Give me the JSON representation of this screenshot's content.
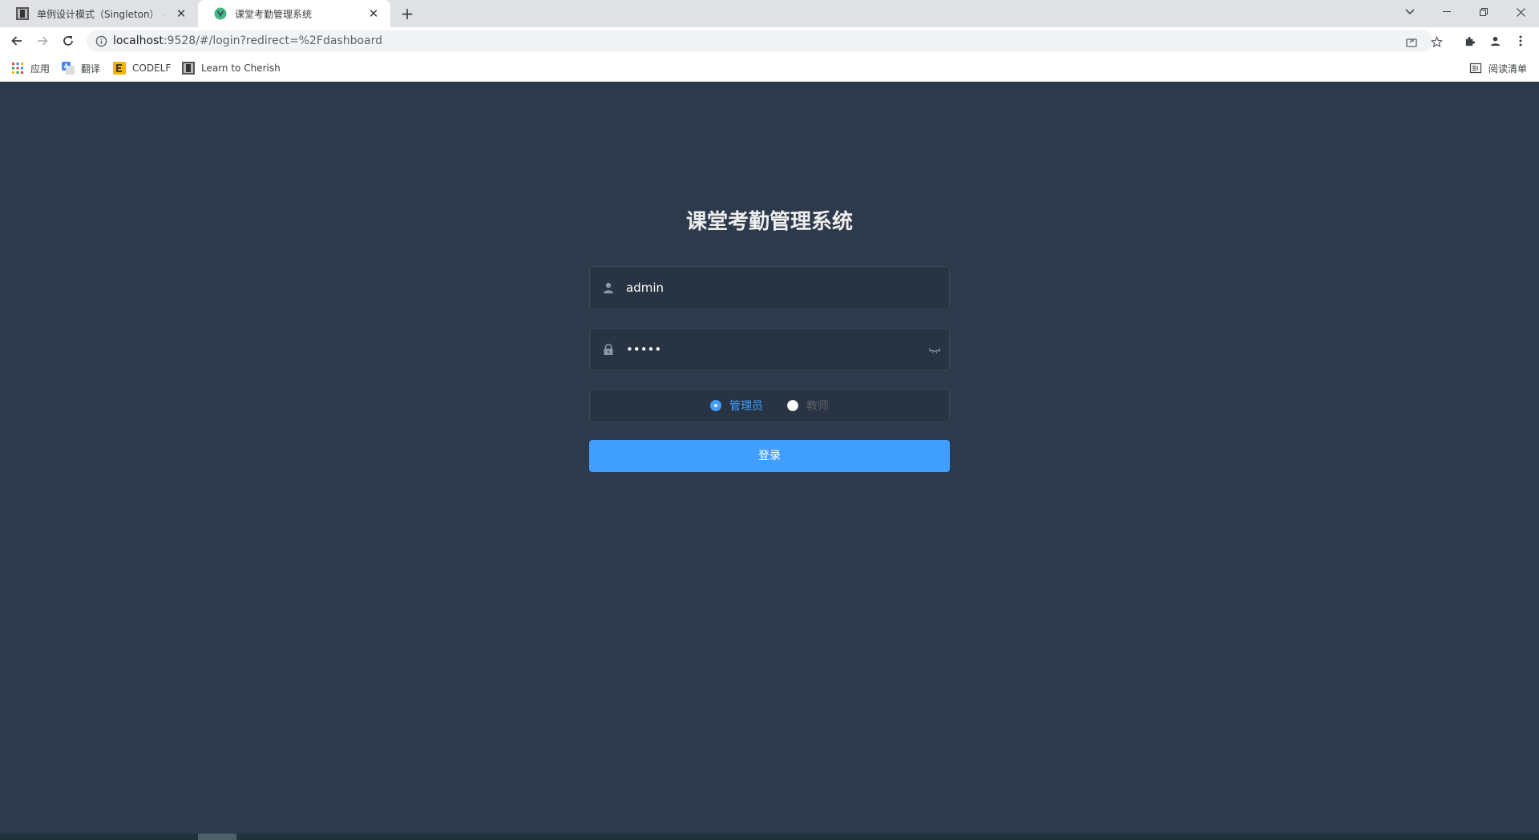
{
  "browser": {
    "tabs": [
      {
        "title": "单例设计模式（Singleton） - Le",
        "close": "✕"
      },
      {
        "title": "课堂考勤管理系统",
        "close": "✕"
      }
    ],
    "new_tab": "+",
    "url_host": "localhost",
    "url_rest": ":9528/#/login?redirect=%2Fdashboard",
    "bookmarks": [
      {
        "label": "应用",
        "icon": "apps-grid-icon"
      },
      {
        "label": "翻译",
        "icon": "translate-icon"
      },
      {
        "label": "CODELF",
        "icon": "codelf-icon"
      },
      {
        "label": "Learn to Cherish",
        "icon": "page-thumbnail-icon"
      }
    ],
    "reading_list": "阅读清单"
  },
  "login": {
    "title": "课堂考勤管理系统",
    "username": "admin",
    "password": "•••••",
    "roles": [
      {
        "label": "管理员",
        "checked": true
      },
      {
        "label": "教师",
        "checked": false
      }
    ],
    "submit": "登录"
  },
  "colors": {
    "background": "#2d3a4b",
    "accent": "#409eff",
    "title": "#eeeeee"
  }
}
